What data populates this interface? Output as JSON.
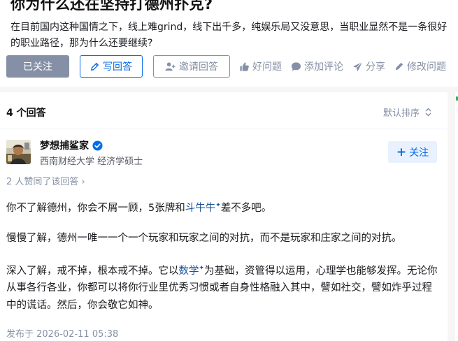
{
  "question": {
    "title": "你为什么还在坚持打德州扑克?",
    "detail": "在目前国内这种国情之下，线上难grind，线下出千多，纯娱乐局又没意思，当职业显然不是一条很好的职业路径，那为什么还要继续?"
  },
  "actions": {
    "followed_label": "已关注",
    "write_answer_label": "写回答",
    "invite_label": "邀请回答",
    "like_label": "好问题",
    "comment_label": "添加评论",
    "share_label": "分享",
    "edit_label": "修改问题"
  },
  "answers": {
    "count_label": "4 个回答",
    "sort_label": "默认排序"
  },
  "answer": {
    "author_name": "梦想捕鲨家",
    "author_bio": "西南财经大学 经济学硕士",
    "follow_label": "关注",
    "upvote_text": "2 人赞同了该回答",
    "upvote_chevron": "›",
    "paragraph1_a": "你不了解德州，你会不屑一顾，5张牌和",
    "paragraph1_link": "斗牛牛",
    "paragraph1_b": "差不多吧。",
    "paragraph2": "慢慢了解，德州一唯一一个一个玩家和玩家之间的对抗，而不是玩家和庄家之间的对抗。",
    "paragraph3_a": "深入了解，戒不掉，根本戒不掉。它以",
    "paragraph3_link": "数学",
    "paragraph3_b": "为基础，资管得以运用，心理学也能够发挥。无论你从事各行各业，你都可以将你行业里优秀习惯或者自身性格融入其中，譬如社交，譬如炸乎过程中的谎话。然后，你会敬它如神。",
    "published": "发布于 2026-02-11 05:38"
  },
  "colors": {
    "brand_blue": "#056de8",
    "muted_gray": "#8590a6",
    "followed_bg": "#8590a6",
    "follow_bg": "#e8f1fd",
    "link_blue": "#175199"
  },
  "icons": {
    "write": "pencil-icon",
    "invite": "add-person-icon",
    "like": "thumbs-up-icon",
    "comment": "comment-bubble-icon",
    "share": "paper-plane-icon",
    "edit": "pencil-icon",
    "sort": "sort-chevrons-icon",
    "verified": "verified-badge-icon"
  }
}
